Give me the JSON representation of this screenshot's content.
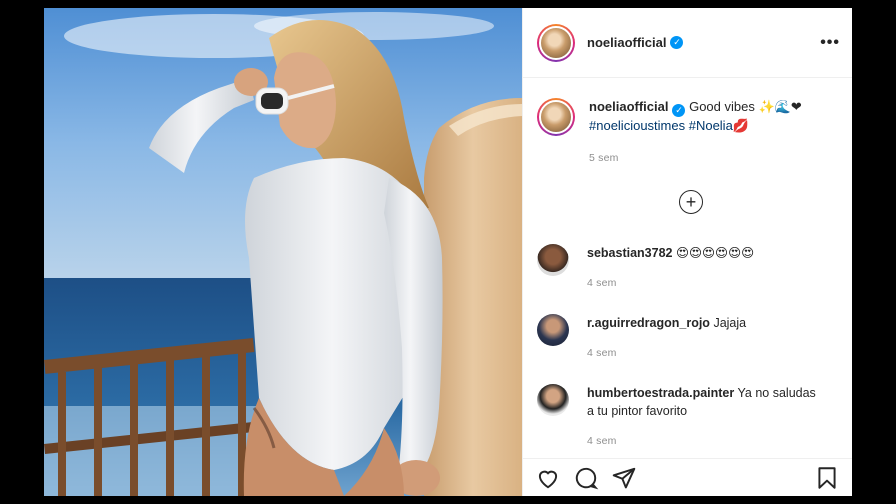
{
  "post": {
    "author": "noeliaofficial",
    "verified_mark": "✓",
    "more_label": "•••",
    "caption_text": "Good vibes ✨🌊❤",
    "hashtags": "#noelicioustimes #Noelia",
    "caption_emoji": "💋",
    "caption_time": "5 sem",
    "load_more_symbol": "+"
  },
  "comments": [
    {
      "username": "sebastian3782",
      "text": "😍😍😍😍😍😍",
      "time": "4 sem",
      "avatar": "avatar-man-dark"
    },
    {
      "username": "r.aguirredragon_rojo",
      "text": "Jajaja",
      "time": "4 sem",
      "avatar": "avatar-man-suit"
    },
    {
      "username": "humbertoestrada.painter",
      "text": "Ya no saludas a tu pintor favorito",
      "time": "4 sem",
      "avatar": "avatar-man-bw"
    }
  ],
  "icons": {
    "like": "heart-icon",
    "comment": "comment-icon",
    "share": "send-icon",
    "save": "bookmark-icon"
  },
  "colors": {
    "story_ring": "#dd2a7b",
    "verified": "#0095f6",
    "hashtag": "#00376b",
    "muted": "#8e8e8e"
  }
}
